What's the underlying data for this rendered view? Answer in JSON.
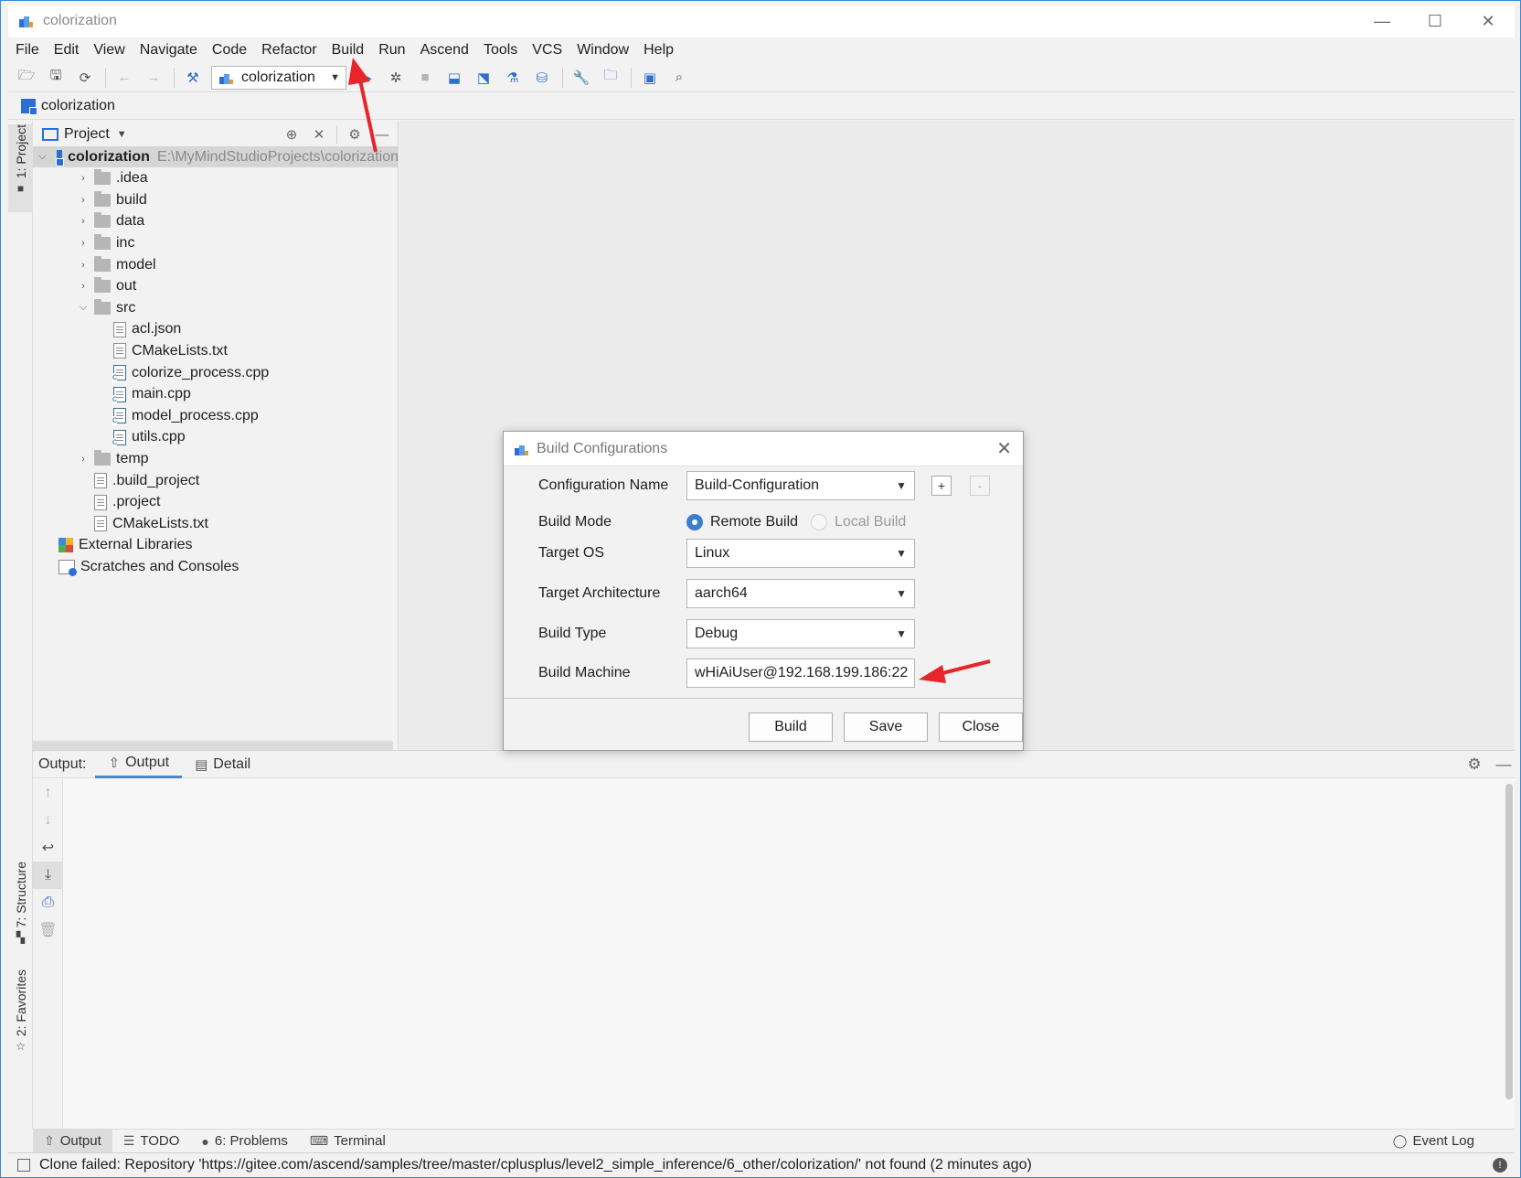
{
  "window": {
    "title": "colorization",
    "minimize": "—",
    "maximize": "☐",
    "close": "✕"
  },
  "menubar": [
    {
      "label": "File",
      "mnemonic": "F",
      "rest": "ile"
    },
    {
      "label": "Edit",
      "mnemonic": "E",
      "rest": "dit"
    },
    {
      "label": "View",
      "mnemonic": "V",
      "rest": "iew"
    },
    {
      "label": "Navigate",
      "mnemonic": "N",
      "rest": "avigate"
    },
    {
      "label": "Code",
      "mnemonic": "C",
      "rest": "ode"
    },
    {
      "label": "Refactor",
      "mnemonic": "R",
      "rest": "efactor"
    },
    {
      "label": "Build",
      "mnemonic": "B",
      "rest": "uild"
    },
    {
      "label": "Run",
      "mnemonic": "R",
      "rest": "un",
      "mnemonic_index": 1
    },
    {
      "label": "Ascend",
      "mnemonic": "A",
      "rest": "scend"
    },
    {
      "label": "Tools",
      "mnemonic": "T",
      "rest": "ools"
    },
    {
      "label": "VCS",
      "mnemonic": "V",
      "rest": "CS",
      "mnemonic_index": 2
    },
    {
      "label": "Window",
      "mnemonic": "W",
      "rest": "indow"
    },
    {
      "label": "Help",
      "mnemonic": "H",
      "rest": "elp"
    }
  ],
  "toolbar": {
    "run_config": "colorization",
    "icons": [
      "open-folder-icon",
      "save-icon",
      "sync-icon",
      "back-icon",
      "forward-icon",
      "build-hammer-icon",
      "run-icon",
      "debug-icon",
      "stop-icon",
      "ascend-upload-icon",
      "ascend-deploy-icon",
      "model-convert-icon",
      "ascend-tool-icon",
      "settings-wrench-icon",
      "project-structure-icon",
      "device-manager-icon",
      "search-icon"
    ]
  },
  "navbar": {
    "project": "colorization"
  },
  "left_stripe": {
    "project_tab": "1: Project",
    "structure_tab": "7: Structure",
    "favorites_tab": "2: Favorites"
  },
  "project_panel": {
    "title": "Project",
    "root": {
      "name": "colorization",
      "path": "E:\\MyMindStudioProjects\\colorization"
    },
    "items": [
      {
        "name": ".idea",
        "type": "folder",
        "expanded": false
      },
      {
        "name": "build",
        "type": "folder",
        "expanded": false
      },
      {
        "name": "data",
        "type": "folder",
        "expanded": false
      },
      {
        "name": "inc",
        "type": "folder",
        "expanded": false
      },
      {
        "name": "model",
        "type": "folder",
        "expanded": false
      },
      {
        "name": "out",
        "type": "folder",
        "expanded": false
      },
      {
        "name": "src",
        "type": "folder",
        "expanded": true
      },
      {
        "name": "acl.json",
        "type": "file"
      },
      {
        "name": "CMakeLists.txt",
        "type": "file"
      },
      {
        "name": "colorize_process.cpp",
        "type": "cpp"
      },
      {
        "name": "main.cpp",
        "type": "cpp"
      },
      {
        "name": "model_process.cpp",
        "type": "cpp"
      },
      {
        "name": "utils.cpp",
        "type": "cpp"
      },
      {
        "name": "temp",
        "type": "folder",
        "expanded": false
      },
      {
        "name": ".build_project",
        "type": "file"
      },
      {
        "name": ".project",
        "type": "file"
      },
      {
        "name": "CMakeLists.txt",
        "type": "file"
      },
      {
        "name": "External Libraries",
        "type": "library"
      },
      {
        "name": "Scratches and Consoles",
        "type": "scratches"
      }
    ]
  },
  "dialog": {
    "title": "Build Configurations",
    "configuration_name_label": "Configuration Name",
    "configuration_name": "Build-Configuration",
    "build_mode_label": "Build Mode",
    "remote_build": "Remote Build",
    "local_build": "Local Build",
    "selected_mode": "Remote Build",
    "target_os_label": "Target OS",
    "target_os": "Linux",
    "target_arch_label": "Target Architecture",
    "target_arch": "aarch64",
    "build_type_label": "Build Type",
    "build_type": "Debug",
    "build_machine_label": "Build Machine",
    "build_machine": "wHiAiUser@192.168.199.186:22",
    "add": "+",
    "remove": "-",
    "build_button": "Build",
    "save_button": "Save",
    "close_button": "Close"
  },
  "output": {
    "label": "Output:",
    "tab_output": "Output",
    "tab_detail": "Detail"
  },
  "bottom_tabs": {
    "output": "Output",
    "todo": "TODO",
    "problems": "6: Problems",
    "terminal": "Terminal",
    "event_log": "Event Log"
  },
  "status": {
    "message": "Clone failed: Repository 'https://gitee.com/ascend/samples/tree/master/cplusplus/level2_simple_inference/6_other/colorization/' not found (2 minutes ago)"
  },
  "colors": {
    "accent": "#2b6fd6",
    "annotation_arrow": "#e8252a",
    "selected_row": "#d5d5d5"
  }
}
